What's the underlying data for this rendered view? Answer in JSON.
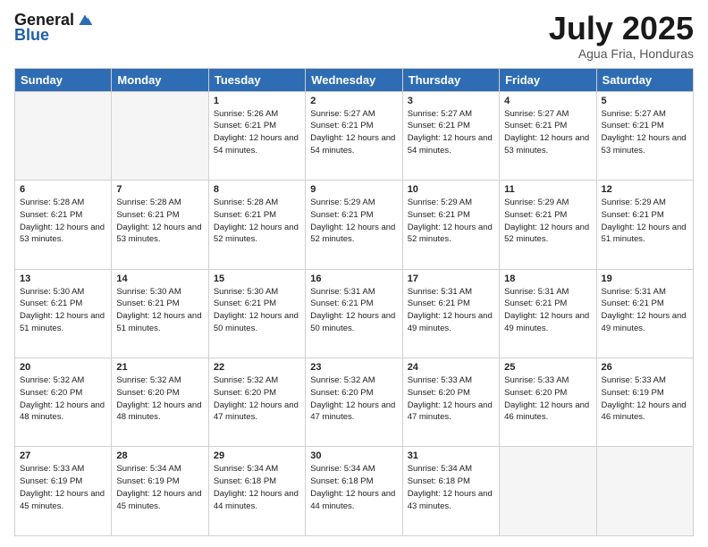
{
  "header": {
    "logo_general": "General",
    "logo_blue": "Blue",
    "title": "July 2025",
    "subtitle": "Agua Fria, Honduras"
  },
  "days_of_week": [
    "Sunday",
    "Monday",
    "Tuesday",
    "Wednesday",
    "Thursday",
    "Friday",
    "Saturday"
  ],
  "weeks": [
    [
      {
        "day": "",
        "info": ""
      },
      {
        "day": "",
        "info": ""
      },
      {
        "day": "1",
        "info": "Sunrise: 5:26 AM\nSunset: 6:21 PM\nDaylight: 12 hours and 54 minutes."
      },
      {
        "day": "2",
        "info": "Sunrise: 5:27 AM\nSunset: 6:21 PM\nDaylight: 12 hours and 54 minutes."
      },
      {
        "day": "3",
        "info": "Sunrise: 5:27 AM\nSunset: 6:21 PM\nDaylight: 12 hours and 54 minutes."
      },
      {
        "day": "4",
        "info": "Sunrise: 5:27 AM\nSunset: 6:21 PM\nDaylight: 12 hours and 53 minutes."
      },
      {
        "day": "5",
        "info": "Sunrise: 5:27 AM\nSunset: 6:21 PM\nDaylight: 12 hours and 53 minutes."
      }
    ],
    [
      {
        "day": "6",
        "info": "Sunrise: 5:28 AM\nSunset: 6:21 PM\nDaylight: 12 hours and 53 minutes."
      },
      {
        "day": "7",
        "info": "Sunrise: 5:28 AM\nSunset: 6:21 PM\nDaylight: 12 hours and 53 minutes."
      },
      {
        "day": "8",
        "info": "Sunrise: 5:28 AM\nSunset: 6:21 PM\nDaylight: 12 hours and 52 minutes."
      },
      {
        "day": "9",
        "info": "Sunrise: 5:29 AM\nSunset: 6:21 PM\nDaylight: 12 hours and 52 minutes."
      },
      {
        "day": "10",
        "info": "Sunrise: 5:29 AM\nSunset: 6:21 PM\nDaylight: 12 hours and 52 minutes."
      },
      {
        "day": "11",
        "info": "Sunrise: 5:29 AM\nSunset: 6:21 PM\nDaylight: 12 hours and 52 minutes."
      },
      {
        "day": "12",
        "info": "Sunrise: 5:29 AM\nSunset: 6:21 PM\nDaylight: 12 hours and 51 minutes."
      }
    ],
    [
      {
        "day": "13",
        "info": "Sunrise: 5:30 AM\nSunset: 6:21 PM\nDaylight: 12 hours and 51 minutes."
      },
      {
        "day": "14",
        "info": "Sunrise: 5:30 AM\nSunset: 6:21 PM\nDaylight: 12 hours and 51 minutes."
      },
      {
        "day": "15",
        "info": "Sunrise: 5:30 AM\nSunset: 6:21 PM\nDaylight: 12 hours and 50 minutes."
      },
      {
        "day": "16",
        "info": "Sunrise: 5:31 AM\nSunset: 6:21 PM\nDaylight: 12 hours and 50 minutes."
      },
      {
        "day": "17",
        "info": "Sunrise: 5:31 AM\nSunset: 6:21 PM\nDaylight: 12 hours and 49 minutes."
      },
      {
        "day": "18",
        "info": "Sunrise: 5:31 AM\nSunset: 6:21 PM\nDaylight: 12 hours and 49 minutes."
      },
      {
        "day": "19",
        "info": "Sunrise: 5:31 AM\nSunset: 6:21 PM\nDaylight: 12 hours and 49 minutes."
      }
    ],
    [
      {
        "day": "20",
        "info": "Sunrise: 5:32 AM\nSunset: 6:20 PM\nDaylight: 12 hours and 48 minutes."
      },
      {
        "day": "21",
        "info": "Sunrise: 5:32 AM\nSunset: 6:20 PM\nDaylight: 12 hours and 48 minutes."
      },
      {
        "day": "22",
        "info": "Sunrise: 5:32 AM\nSunset: 6:20 PM\nDaylight: 12 hours and 47 minutes."
      },
      {
        "day": "23",
        "info": "Sunrise: 5:32 AM\nSunset: 6:20 PM\nDaylight: 12 hours and 47 minutes."
      },
      {
        "day": "24",
        "info": "Sunrise: 5:33 AM\nSunset: 6:20 PM\nDaylight: 12 hours and 47 minutes."
      },
      {
        "day": "25",
        "info": "Sunrise: 5:33 AM\nSunset: 6:20 PM\nDaylight: 12 hours and 46 minutes."
      },
      {
        "day": "26",
        "info": "Sunrise: 5:33 AM\nSunset: 6:19 PM\nDaylight: 12 hours and 46 minutes."
      }
    ],
    [
      {
        "day": "27",
        "info": "Sunrise: 5:33 AM\nSunset: 6:19 PM\nDaylight: 12 hours and 45 minutes."
      },
      {
        "day": "28",
        "info": "Sunrise: 5:34 AM\nSunset: 6:19 PM\nDaylight: 12 hours and 45 minutes."
      },
      {
        "day": "29",
        "info": "Sunrise: 5:34 AM\nSunset: 6:18 PM\nDaylight: 12 hours and 44 minutes."
      },
      {
        "day": "30",
        "info": "Sunrise: 5:34 AM\nSunset: 6:18 PM\nDaylight: 12 hours and 44 minutes."
      },
      {
        "day": "31",
        "info": "Sunrise: 5:34 AM\nSunset: 6:18 PM\nDaylight: 12 hours and 43 minutes."
      },
      {
        "day": "",
        "info": ""
      },
      {
        "day": "",
        "info": ""
      }
    ]
  ]
}
